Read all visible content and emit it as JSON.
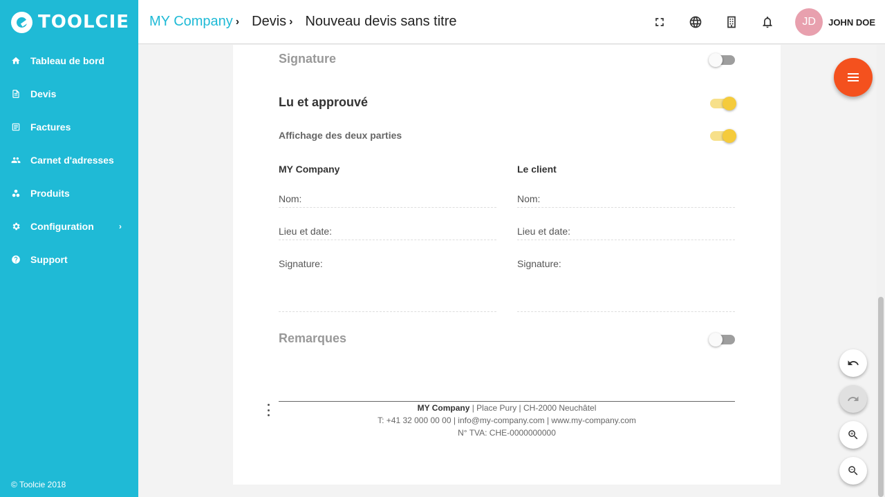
{
  "app": {
    "logo_text": "TOOLCIE",
    "accent": "#1fbad6"
  },
  "sidebar": {
    "items": [
      {
        "label": "Tableau de bord",
        "icon": "home-icon"
      },
      {
        "label": "Devis",
        "icon": "quote-icon"
      },
      {
        "label": "Factures",
        "icon": "invoice-icon"
      },
      {
        "label": "Carnet d'adresses",
        "icon": "people-icon"
      },
      {
        "label": "Produits",
        "icon": "products-icon"
      },
      {
        "label": "Configuration",
        "icon": "gear-icon"
      },
      {
        "label": "Support",
        "icon": "help-icon"
      }
    ],
    "copyright": "© Toolcie 2018"
  },
  "header": {
    "breadcrumbs": [
      "MY Company",
      "Devis",
      "Nouveau devis sans titre"
    ],
    "separator": "›",
    "user": {
      "initials": "JD",
      "name": "JOHN DOE"
    }
  },
  "document": {
    "signature_title": "Signature",
    "signature_enabled": false,
    "approved_title": "Lu et approuvé",
    "approved_enabled": true,
    "both_parties_label": "Affichage des deux parties",
    "both_parties_enabled": true,
    "left_party": "MY Company",
    "right_party": "Le client",
    "name_label": "Nom:",
    "place_date_label": "Lieu et date:",
    "signature_label": "Signature:",
    "remarks_title": "Remarques",
    "remarks_enabled": false,
    "footer": {
      "company": "MY Company",
      "address": " | Place Pury | CH-2000 Neuchâtel",
      "contact": "T: +41 32 000 00 00 | info@my-company.com | www.my-company.com",
      "vat": "N° TVA: CHE-0000000000"
    }
  }
}
